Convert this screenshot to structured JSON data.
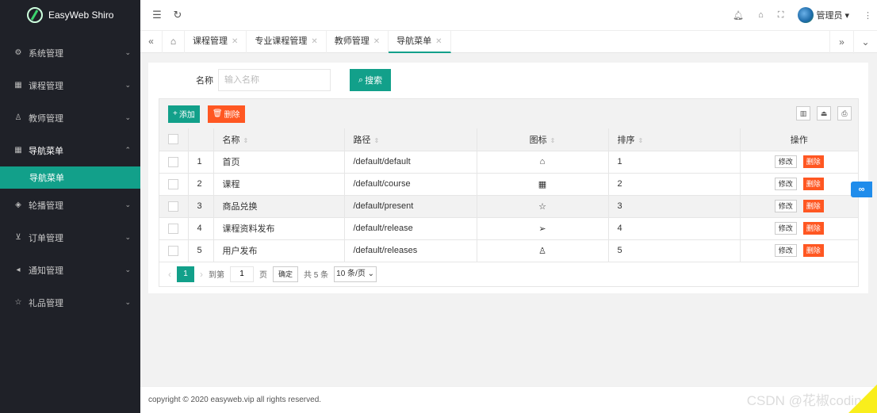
{
  "app": {
    "name": "EasyWeb Shiro"
  },
  "sidebar": {
    "items": [
      {
        "label": "系统管理",
        "icon": "gear-icon"
      },
      {
        "label": "课程管理",
        "icon": "grid-icon"
      },
      {
        "label": "教师管理",
        "icon": "user-icon"
      },
      {
        "label": "导航菜单",
        "icon": "grid-icon",
        "open": true
      },
      {
        "label": "轮播管理",
        "icon": "cube-icon"
      },
      {
        "label": "订单管理",
        "icon": "cart-icon"
      },
      {
        "label": "通知管理",
        "icon": "speaker-icon"
      },
      {
        "label": "礼品管理",
        "icon": "star-icon"
      }
    ],
    "submenu": {
      "label": "导航菜单"
    }
  },
  "header": {
    "user": "管理员"
  },
  "tabs": [
    {
      "label": "课程管理"
    },
    {
      "label": "专业课程管理"
    },
    {
      "label": "教师管理"
    },
    {
      "label": "导航菜单",
      "active": true
    }
  ],
  "search": {
    "label": "名称",
    "placeholder": "输入名称",
    "button": "搜索"
  },
  "toolbar": {
    "add": "添加",
    "delete": "删除"
  },
  "table": {
    "headers": [
      "名称",
      "路径",
      "图标",
      "排序",
      "操作"
    ],
    "rows": [
      {
        "no": "1",
        "name": "首页",
        "path": "/default/default",
        "icon": "home-icon",
        "sort": "1"
      },
      {
        "no": "2",
        "name": "课程",
        "path": "/default/course",
        "icon": "apps-icon",
        "sort": "2"
      },
      {
        "no": "3",
        "name": "商品兑换",
        "path": "/default/present",
        "icon": "star-icon",
        "sort": "3"
      },
      {
        "no": "4",
        "name": "课程资料发布",
        "path": "/default/release",
        "icon": "send-icon",
        "sort": "4"
      },
      {
        "no": "5",
        "name": "用户发布",
        "path": "/default/releases",
        "icon": "user-icon",
        "sort": "5"
      }
    ],
    "edit_label": "修改",
    "delete_label": "删除"
  },
  "pager": {
    "current": "1",
    "goto_prefix": "到第",
    "goto_value": "1",
    "goto_suffix": "页",
    "confirm": "确定",
    "total": "共 5 条",
    "page_size": "10 条/页"
  },
  "footer": {
    "text": "copyright © 2020 easyweb.vip all rights reserved."
  },
  "watermark": "CSDN @花椒coding",
  "colors": {
    "accent": "#12a08a",
    "danger": "#ff5722",
    "sidebar": "#1f2128"
  }
}
